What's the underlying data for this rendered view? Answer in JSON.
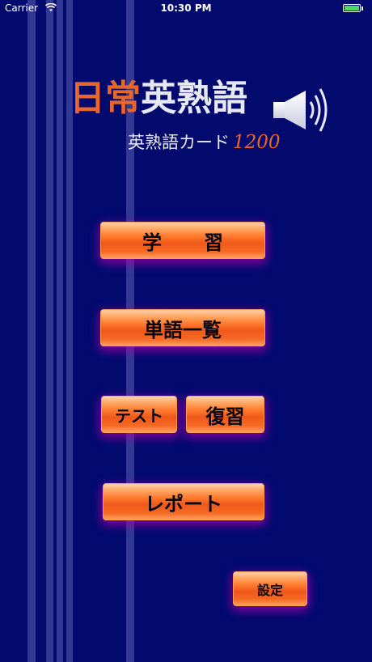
{
  "status_bar": {
    "carrier": "Carrier",
    "time": "10:30 PM",
    "battery_level": 1.0,
    "battery_color": "#4cd964"
  },
  "logo": {
    "title_part1": "日常",
    "title_part2": "英熟語",
    "subtitle": "英熟語カード",
    "subtitle_number": "1200",
    "icon": "speaker-icon"
  },
  "menu": {
    "study": "学習",
    "word_list": "単語一覧",
    "test": "テスト",
    "review": "復習",
    "report": "レポート",
    "settings": "設定"
  },
  "colors": {
    "background": "#020a6e",
    "accent": "#e8662c",
    "button_orange": "#ff7c2e",
    "button_glow": "#aa00aa"
  }
}
